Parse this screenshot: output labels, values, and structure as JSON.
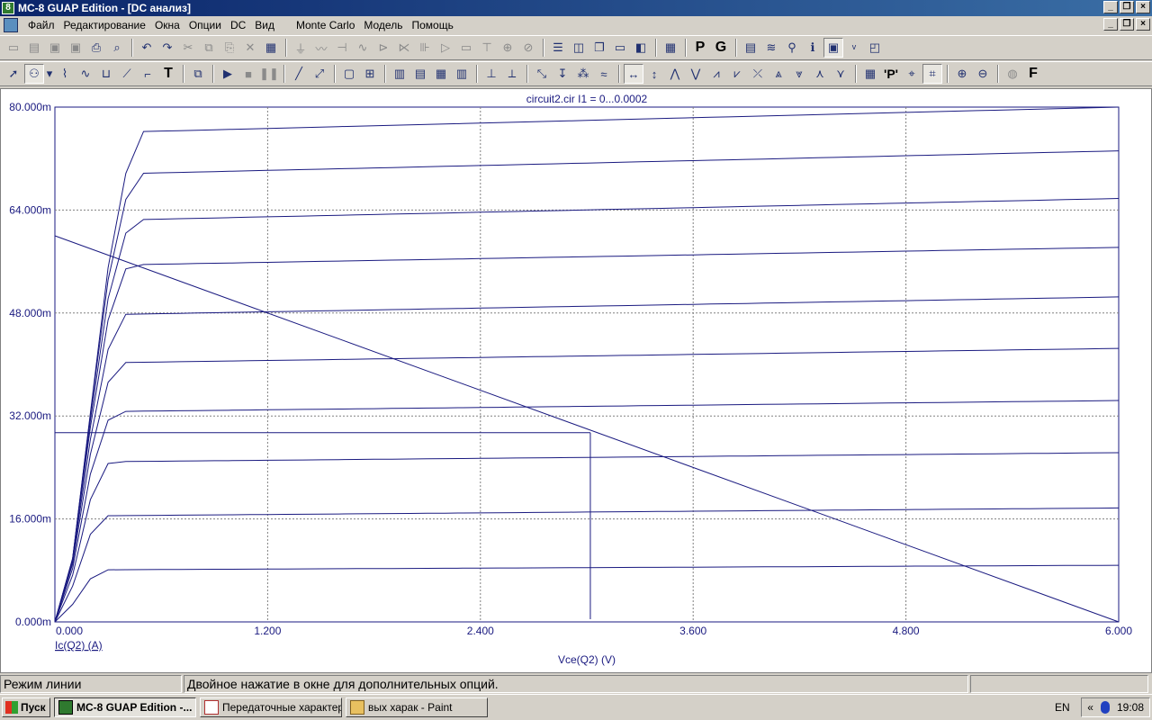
{
  "window": {
    "title": "MC-8 GUAP Edition - [DC анализ]",
    "app_icon_text": "8"
  },
  "menu": {
    "items": [
      "Файл",
      "Редактирование",
      "Окна",
      "Опции",
      "DC",
      "Вид",
      "Monte Carlo",
      "Модель",
      "Помощь"
    ]
  },
  "toolbar1": {
    "letters": [
      "P",
      "G"
    ]
  },
  "toolbar2": {
    "letters": [
      "T",
      "F"
    ],
    "p_label": "'P'"
  },
  "chart_data": {
    "type": "line",
    "title": "circuit2.cir I1 = 0...0.0002",
    "xlabel": "Vce(Q2) (V)",
    "ylabel": "Ic(Q2) (A)",
    "xlim": [
      0,
      6
    ],
    "ylim": [
      0,
      0.08
    ],
    "x_ticks": [
      "0.000",
      "1.200",
      "2.400",
      "3.600",
      "4.800",
      "6.000"
    ],
    "y_ticks": [
      "0.000m",
      "16.000m",
      "32.000m",
      "48.000m",
      "64.000m",
      "80.000m"
    ],
    "grid": true,
    "series_note": "10 transistor output characteristics, plus load line",
    "curves": [
      {
        "sat_current": 0.0081,
        "end_current": 0.0088,
        "knee_v": 0.22
      },
      {
        "sat_current": 0.0165,
        "end_current": 0.0177,
        "knee_v": 0.22
      },
      {
        "sat_current": 0.0249,
        "end_current": 0.0263,
        "knee_v": 0.24
      },
      {
        "sat_current": 0.0327,
        "end_current": 0.0344,
        "knee_v": 0.26
      },
      {
        "sat_current": 0.0403,
        "end_current": 0.0425,
        "knee_v": 0.28
      },
      {
        "sat_current": 0.0478,
        "end_current": 0.0505,
        "knee_v": 0.3
      },
      {
        "sat_current": 0.0555,
        "end_current": 0.0582,
        "knee_v": 0.32
      },
      {
        "sat_current": 0.0625,
        "end_current": 0.0658,
        "knee_v": 0.34
      },
      {
        "sat_current": 0.0697,
        "end_current": 0.0732,
        "knee_v": 0.36
      },
      {
        "sat_current": 0.0762,
        "end_current": 0.08,
        "knee_v": 0.38
      }
    ],
    "load_line": {
      "x": [
        0,
        6
      ],
      "y": [
        0.06,
        0
      ]
    },
    "operating_point": {
      "x": 3.02,
      "y": 0.0294
    }
  },
  "status": {
    "mode": "Режим линии",
    "hint": "Двойное нажатие в окне для дополнительных опций."
  },
  "taskbar": {
    "start": "Пуск",
    "tasks": [
      "MC-8 GUAP Edition -...",
      "Передаточные характер...",
      "вых харак - Paint"
    ],
    "lang": "EN",
    "time": "19:08",
    "tray_arrows": "«"
  },
  "colors": {
    "curve": "#1a1a80",
    "axis_text": "#1a1a80",
    "grid": "#808080"
  }
}
